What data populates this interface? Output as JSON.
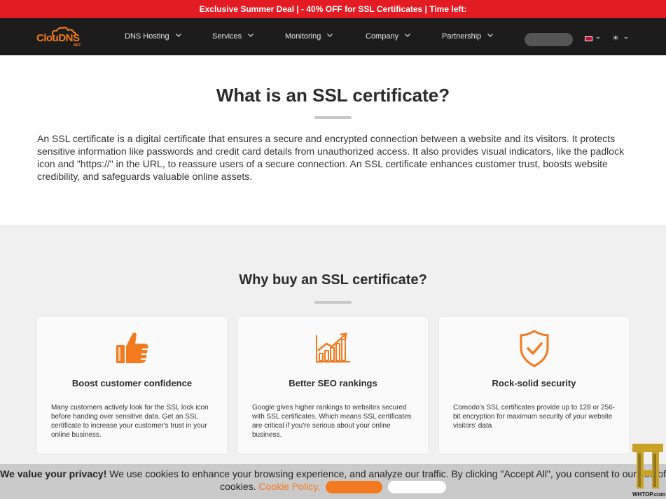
{
  "promo": {
    "text": "Exclusive Summer Deal | - 40% OFF for SSL Certificates | Time left:"
  },
  "logo": {
    "text": "ClouDNS",
    "sub": ".NET"
  },
  "menu": [
    {
      "label": "DNS Hosting"
    },
    {
      "label": "Services"
    },
    {
      "label": "Monitoring"
    },
    {
      "label": "Company"
    },
    {
      "label": "Partnership"
    }
  ],
  "hero": {
    "title": "What is an SSL certificate?",
    "text": "An SSL certificate is a digital certificate that ensures a secure and encrypted connection between a website and its visitors. It protects sensitive information like passwords and credit card details from unauthorized access. It also provides visual indicators, like the padlock icon and \"https://\" in the URL, to reassure users of a secure connection. An SSL certificate enhances customer trust, boosts website credibility, and safeguards valuable online assets."
  },
  "why": {
    "title": "Why buy an SSL certificate?",
    "cards": [
      {
        "icon": "thumbs-up-icon",
        "title": "Boost customer confidence",
        "text": "Many customers actively look for the SSL lock icon before handing over sensitive data. Get an SSL certificate to increase your customer's trust in your online business."
      },
      {
        "icon": "growth-chart-icon",
        "title": "Better SEO rankings",
        "text": "Google gives higher rankings to websites secured with SSL certificates. Which means SSL certificates are critical if you're serious about your online business."
      },
      {
        "icon": "shield-check-icon",
        "title": "Rock-solid security",
        "text": "Comodo's SSL certificates provide up to 128 or 256-bit encryption for maximum security of your website visitors' data"
      }
    ]
  },
  "cookie": {
    "lead": "We value your privacy!",
    "text": " We use cookies to enhance your browsing experience, and analyze our traffic. By clicking \"Accept All\", you consent to our use of cookies.",
    "link": "Cookie Policy."
  },
  "watermark": {
    "text": "WHTOP.com"
  },
  "colors": {
    "accent": "#f47a20",
    "promo": "#e31b23",
    "nav": "#1c1c1c",
    "section_bg": "#f0f0f0"
  }
}
